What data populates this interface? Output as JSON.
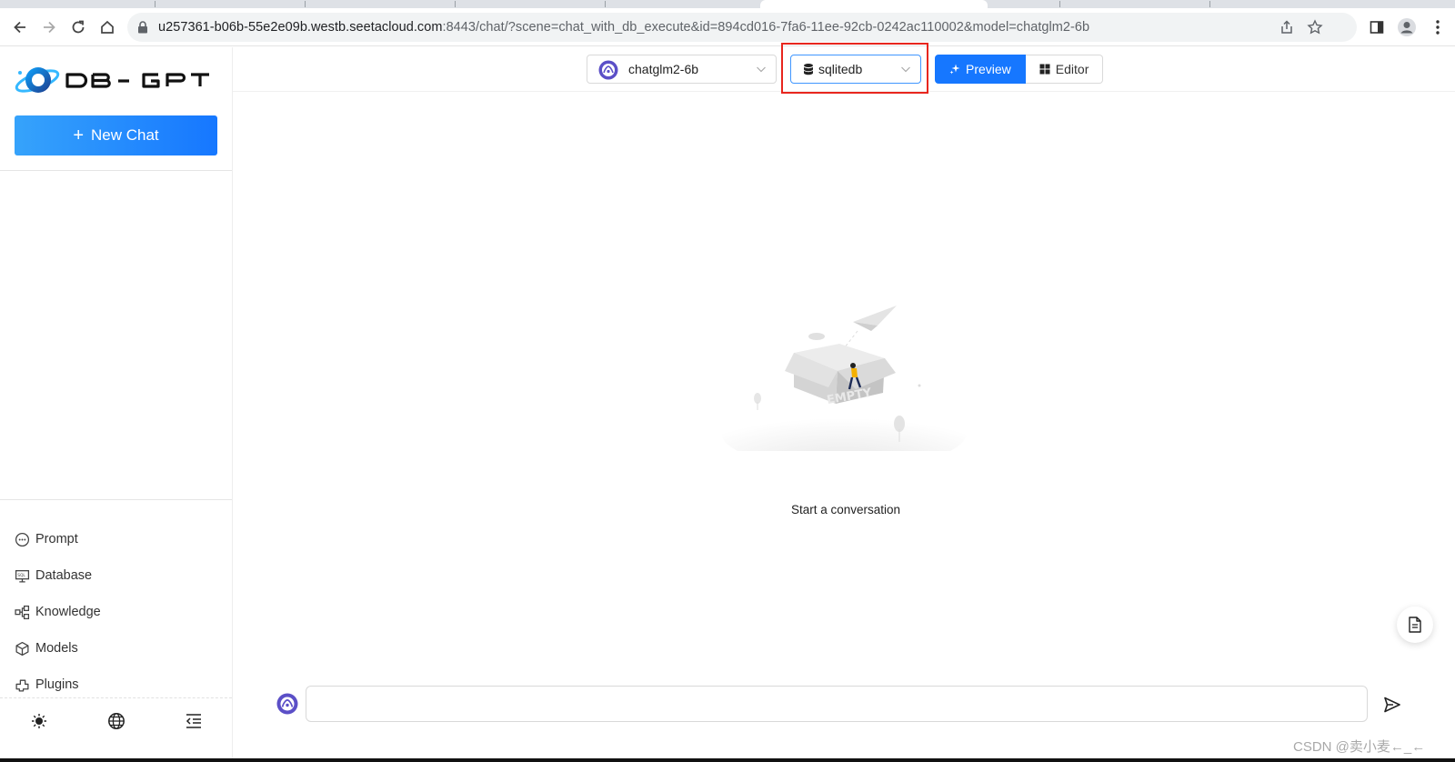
{
  "browser": {
    "url_host": "u257361-b06b-55e2e09b.westb.seetacloud.com",
    "url_rest": ":8443/chat/?scene=chat_with_db_execute&id=894cd016-7fa6-11ee-92cb-0242ac110002&model=chatglm2-6b"
  },
  "sidebar": {
    "logo_text": "DB-GPT",
    "new_chat_label": "New Chat",
    "menu": [
      {
        "label": "Prompt",
        "icon": "message-icon"
      },
      {
        "label": "Database",
        "icon": "database-icon"
      },
      {
        "label": "Knowledge",
        "icon": "knowledge-icon"
      },
      {
        "label": "Models",
        "icon": "cube-icon"
      },
      {
        "label": "Plugins",
        "icon": "plugin-icon"
      }
    ],
    "bottom_icons": [
      "sun-icon",
      "globe-icon",
      "collapse-menu-icon"
    ]
  },
  "header": {
    "model_value": "chatglm2-6b",
    "db_value": "sqlitedb",
    "mode_tabs": [
      {
        "label": "Preview",
        "active": true
      },
      {
        "label": "Editor",
        "active": false
      }
    ]
  },
  "main": {
    "empty_label": "EMPTY",
    "empty_text": "Start a conversation"
  },
  "input": {
    "value": "",
    "placeholder": ""
  },
  "watermark": "CSDN @卖小麦←_←",
  "colors": {
    "accent": "#1677ff",
    "highlight": "#e8261e"
  }
}
